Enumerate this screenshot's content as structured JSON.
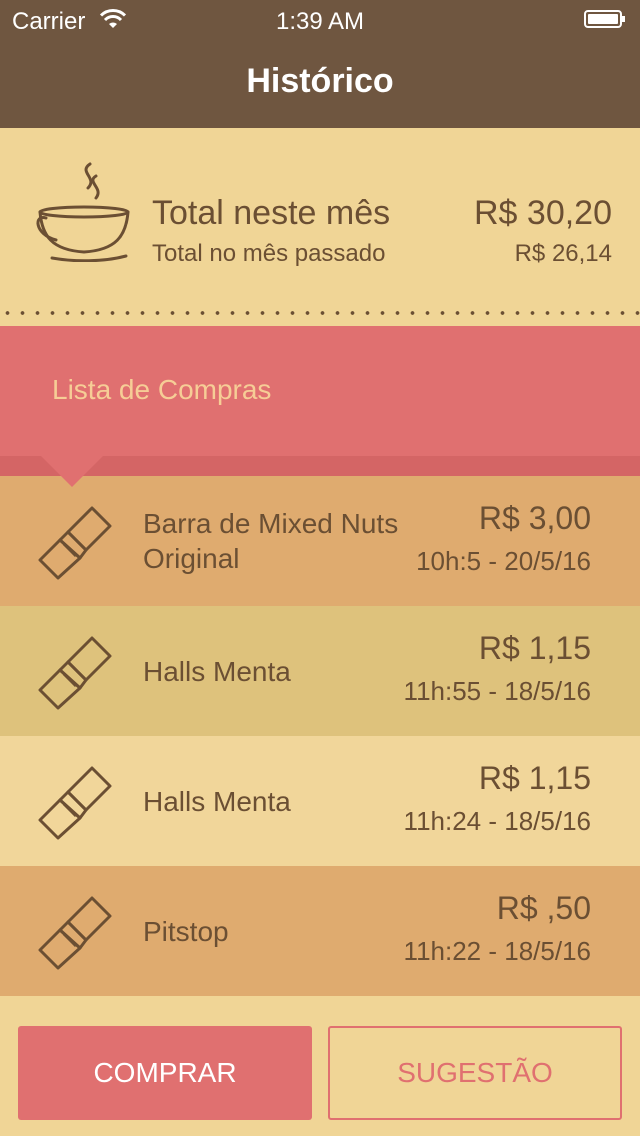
{
  "status_bar": {
    "carrier": "Carrier",
    "time": "1:39 AM"
  },
  "nav": {
    "title": "Histórico"
  },
  "summary": {
    "title": "Total neste mês",
    "subtitle": "Total no mês passado",
    "total": "R$ 30,20",
    "previous": "R$ 26,14",
    "icon": "coffee-cup-icon"
  },
  "list_header": {
    "label": "Lista de Compras"
  },
  "items": [
    {
      "name": "Barra de Mixed Nuts Original",
      "price": "R$ 3,00",
      "time": "10h:5 - 20/5/16",
      "color": "#dfab6f",
      "icon": "snack-bar-icon"
    },
    {
      "name": "Halls Menta",
      "price": "R$ 1,15",
      "time": "11h:55 - 18/5/16",
      "color": "#dec27c",
      "icon": "snack-bar-icon"
    },
    {
      "name": "Halls Menta",
      "price": "R$ 1,15",
      "time": "11h:24 - 18/5/16",
      "color": "#f1d69a",
      "icon": "snack-bar-icon"
    },
    {
      "name": "Pitstop",
      "price": "R$ ,50",
      "time": "11h:22 - 18/5/16",
      "color": "#dfab6f",
      "icon": "snack-bar-icon"
    }
  ],
  "buttons": {
    "buy": "COMPRAR",
    "suggest": "SUGESTÃO"
  },
  "colors": {
    "nav": "#6f5640",
    "accent": "#e07070",
    "text": "#6b4f33",
    "background": "#f0d596"
  }
}
